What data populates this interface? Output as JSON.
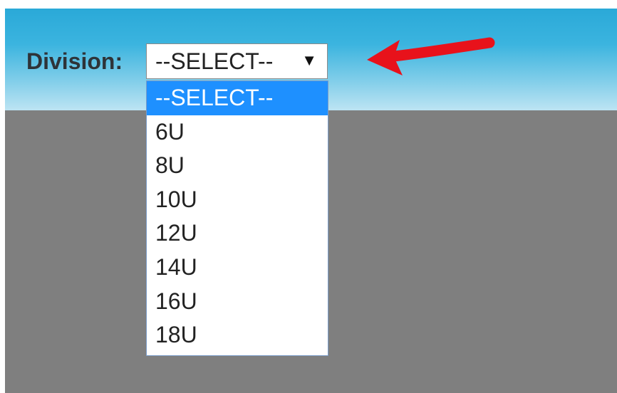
{
  "form": {
    "division_label": "Division:",
    "division_select": {
      "selected_value": "--SELECT--",
      "caret_glyph": "▼",
      "options": [
        {
          "label": "--SELECT--",
          "highlighted": true
        },
        {
          "label": "6U",
          "highlighted": false
        },
        {
          "label": "8U",
          "highlighted": false
        },
        {
          "label": "10U",
          "highlighted": false
        },
        {
          "label": "12U",
          "highlighted": false
        },
        {
          "label": "14U",
          "highlighted": false
        },
        {
          "label": "16U",
          "highlighted": false
        },
        {
          "label": "18U",
          "highlighted": false
        }
      ]
    }
  },
  "annotation": {
    "arrow_icon": "red-arrow-left-icon",
    "arrow_color": "#e8121b"
  },
  "colors": {
    "header_gradient_top": "#2aa9d8",
    "header_gradient_bottom": "#bde4f3",
    "page_background": "#7f7f7f",
    "option_highlight": "#1e90ff"
  }
}
